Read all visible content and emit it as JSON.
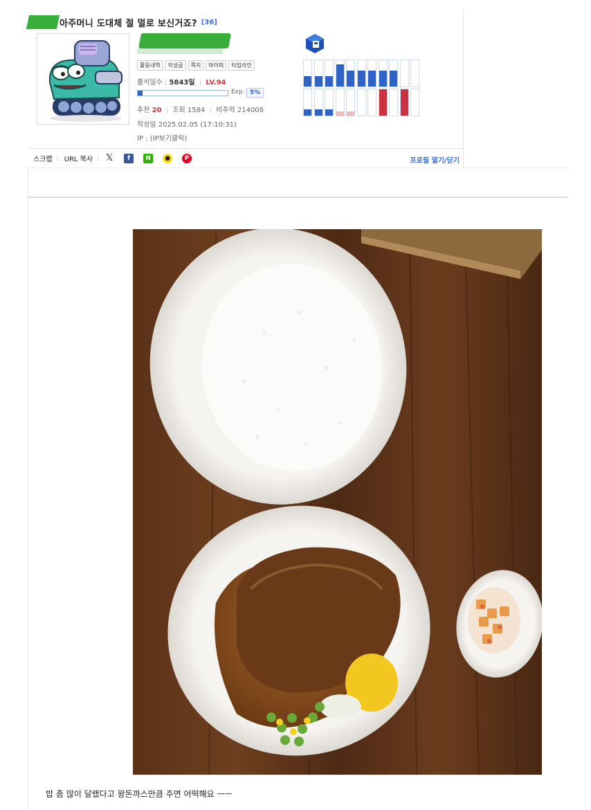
{
  "post": {
    "title": "아주머니 도대체 절 멀로 보신거죠?",
    "comment_count": "[36]"
  },
  "profile": {
    "buttons": [
      "활동내역",
      "작성글",
      "쪽지",
      "마이피",
      "타임라인"
    ],
    "attendance_label": "출석일수 :",
    "attendance_value": "5843일",
    "level": "LV.94",
    "exp_label": "Exp.",
    "exp_value": "5%",
    "exp_fraction": 0.05,
    "recommend_label": "추천",
    "recommend_value": "20",
    "views_label": "조회",
    "views_value": "1584",
    "nonrec_label": "비추력",
    "nonrec_value": "214008",
    "date_label": "작성일",
    "date_value": "2025.02.05 (17:10:31)",
    "ip_label": "IP :",
    "ip_value": "(IP보기클릭)"
  },
  "activity_graph": {
    "top_levels": [
      0.4,
      0.4,
      0.4,
      0.85,
      0.6,
      0.6,
      0.6,
      0.6,
      0.6,
      0.0,
      0.0
    ],
    "bottom_levels": [
      0.25,
      0.25,
      0.25,
      0.15,
      0.15,
      0.0,
      0.0,
      1.0,
      0.0,
      1.0,
      0.0
    ],
    "bottom_colors": [
      "#2f63c6",
      "#2f63c6",
      "#2f63c6",
      "#f2b8c0",
      "#f2b8c0",
      "#2f63c6",
      "#2f63c6",
      "#c9323e",
      "#2f63c6",
      "#c9323e",
      "#2f63c6"
    ],
    "top_colors": "#2f63c6"
  },
  "share": {
    "scrap": "스크랩",
    "url_copy": "URL 복사",
    "icons": [
      "x-icon",
      "facebook-icon",
      "naver-icon",
      "kakaotalk-icon",
      "pinterest-icon"
    ],
    "profile_toggle": "프로필 열기/닫기"
  },
  "body": {
    "caption": "밥 좀 많이 달랬다고 왕돈까스만큼 주면 어떡해요 ㅡㅡ"
  },
  "colors": {
    "accent_blue": "#2f63c6",
    "accent_red": "#d6383f",
    "censor_green": "#3aae3a"
  }
}
